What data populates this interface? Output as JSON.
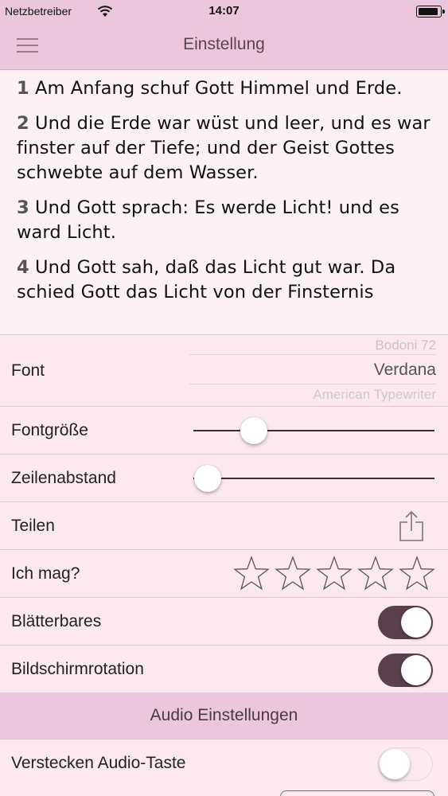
{
  "status": {
    "carrier": "Netzbetreiber",
    "time": "14:07"
  },
  "nav": {
    "title": "Einstellung"
  },
  "verses": [
    {
      "num": "1",
      "text": "Am Anfang schuf Gott Himmel und Erde."
    },
    {
      "num": "2",
      "text": "Und die Erde war wüst und leer, und es war finster auf der Tiefe; und der Geist Gottes schwebte auf dem Wasser."
    },
    {
      "num": "3",
      "text": "Und Gott sprach: Es werde Licht! und es ward Licht."
    },
    {
      "num": "4",
      "text": "Und Gott sah, daß das Licht gut war. Da schied Gott das Licht von der Finsternis"
    }
  ],
  "settings": {
    "font": {
      "label": "Font",
      "options": [
        "Bodoni 72",
        "Verdana",
        "American Typewriter"
      ],
      "selected": "Verdana"
    },
    "font_size": {
      "label": "Fontgröße",
      "value": 0.25
    },
    "line_spacing": {
      "label": "Zeilenabstand",
      "value": 0.06
    },
    "share": {
      "label": "Teilen",
      "icon": "share-icon"
    },
    "rating": {
      "label": "Ich mag?",
      "stars": 5,
      "rated": 0
    },
    "pageable": {
      "label": "Blätterbares",
      "on": true
    },
    "screen_rotation": {
      "label": "Bildschirmrotation",
      "on": true
    }
  },
  "audio": {
    "header": "Audio Einstellungen",
    "hide_audio_button": {
      "label": "Verstecken Audio-Taste",
      "on": false
    }
  },
  "colors": {
    "bar": "#ebc6dc",
    "background": "#fce9ef",
    "toggle_on": "#5a3f4d"
  }
}
